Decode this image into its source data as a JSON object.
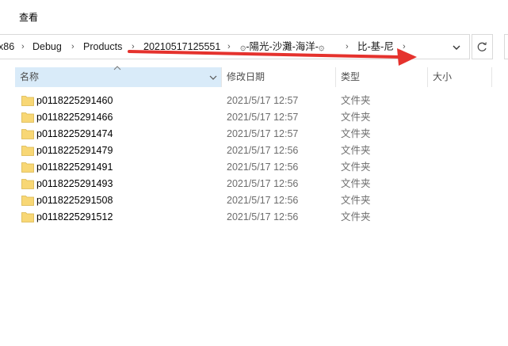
{
  "menubar": {
    "view_label": "查看"
  },
  "address": {
    "crumbs": [
      "x86",
      "Debug",
      "Products",
      "20210517125551",
      "۞-陽光-沙灘-海洋-۞",
      "比-基-尼"
    ],
    "separator": "›"
  },
  "columns": {
    "name": "名称",
    "date_modified": "修改日期",
    "type": "类型",
    "size": "大小"
  },
  "files": [
    {
      "name": "p0118225291460",
      "date": "2021/5/17 12:57",
      "type": "文件夹"
    },
    {
      "name": "p0118225291466",
      "date": "2021/5/17 12:57",
      "type": "文件夹"
    },
    {
      "name": "p0118225291474",
      "date": "2021/5/17 12:57",
      "type": "文件夹"
    },
    {
      "name": "p0118225291479",
      "date": "2021/5/17 12:56",
      "type": "文件夹"
    },
    {
      "name": "p0118225291491",
      "date": "2021/5/17 12:56",
      "type": "文件夹"
    },
    {
      "name": "p0118225291493",
      "date": "2021/5/17 12:56",
      "type": "文件夹"
    },
    {
      "name": "p0118225291508",
      "date": "2021/5/17 12:56",
      "type": "文件夹"
    },
    {
      "name": "p0118225291512",
      "date": "2021/5/17 12:56",
      "type": "文件夹"
    }
  ],
  "colors": {
    "header_selected": "#d9ebf9",
    "folder": "#f8d775",
    "annotation_arrow": "#e5322d"
  }
}
